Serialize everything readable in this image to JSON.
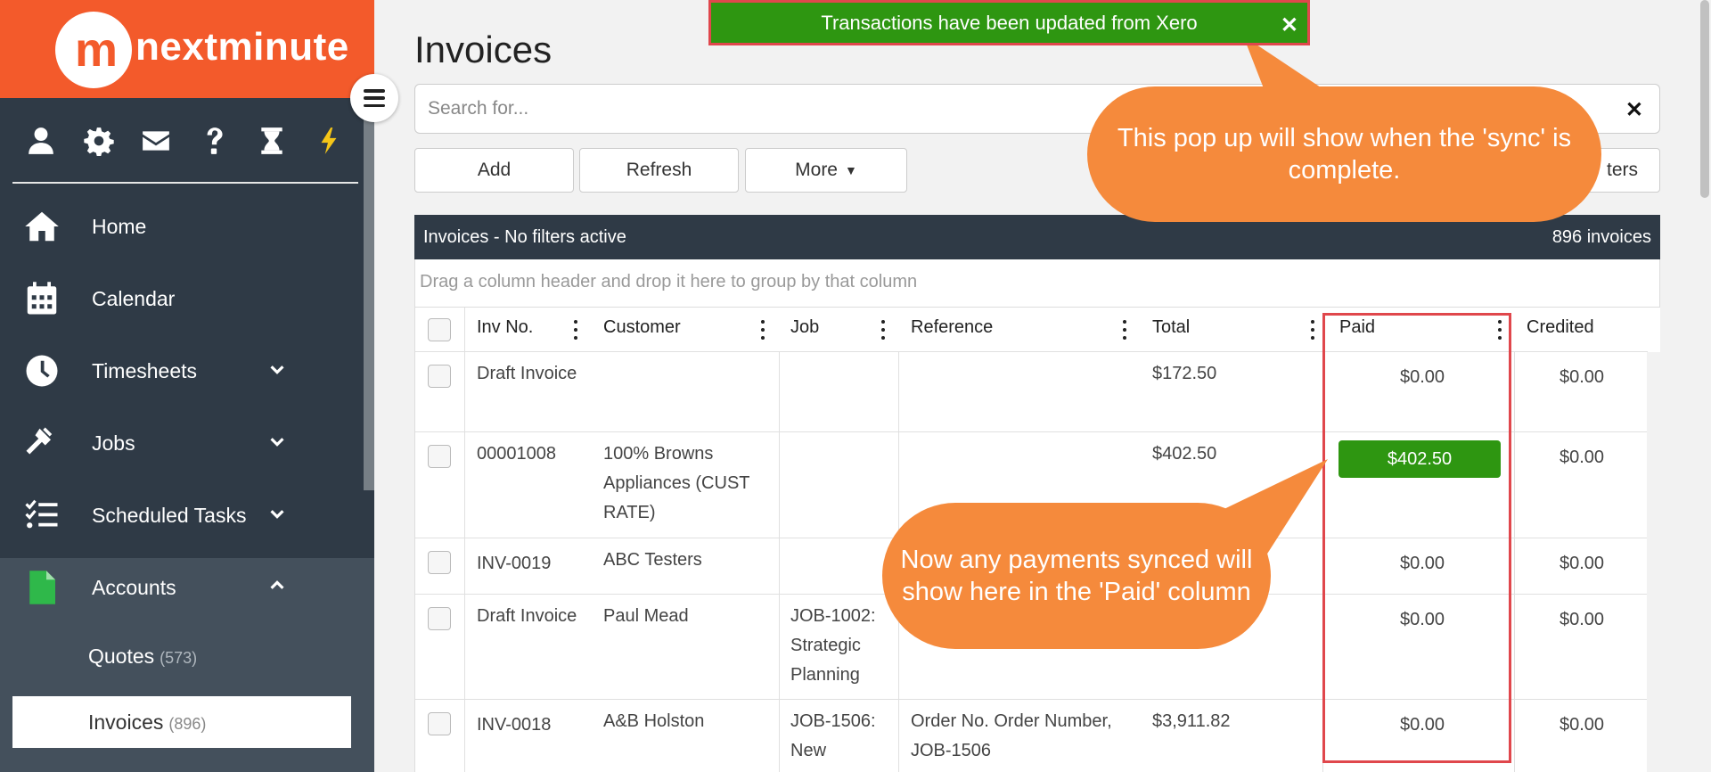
{
  "brand": {
    "logo_mark": "m",
    "logo_text": "nextminute",
    "color": "#f35a2b"
  },
  "top_icons": [
    "user-icon",
    "gear-icon",
    "envelope-icon",
    "question-icon",
    "hourglass-icon",
    "lightning-icon"
  ],
  "sidebar": {
    "items": [
      {
        "label": "Home",
        "icon": "home-icon"
      },
      {
        "label": "Calendar",
        "icon": "calendar-icon"
      },
      {
        "label": "Timesheets",
        "icon": "clock-icon",
        "expandable": true
      },
      {
        "label": "Jobs",
        "icon": "hammer-icon",
        "expandable": true
      },
      {
        "label": "Scheduled Tasks",
        "icon": "tasks-icon",
        "expandable": true
      },
      {
        "label": "Accounts",
        "icon": "file-icon",
        "expanded": true
      }
    ],
    "sub_items": [
      {
        "label": "Quotes",
        "count": "(573)"
      },
      {
        "label": "Invoices",
        "count": "(896)",
        "selected": true
      }
    ]
  },
  "page": {
    "title": "Invoices"
  },
  "search": {
    "placeholder": "Search for...",
    "value": "",
    "clear": "✕"
  },
  "toolbar": {
    "add": "Add",
    "refresh": "Refresh",
    "more": "More",
    "more_caret": "▼",
    "filters_partial": "ters"
  },
  "grid": {
    "title": "Invoices - No filters active",
    "count": "896 invoices",
    "group_hint": "Drag a column header and drop it here to group by that column",
    "columns": [
      "Inv No.",
      "Customer",
      "Job",
      "Reference",
      "Total",
      "Paid",
      "Credited"
    ],
    "rows": [
      {
        "inv_no": "Draft Invoice",
        "customer": "",
        "job": "",
        "reference": "",
        "total": "$172.50",
        "paid": "$0.00",
        "credited": "$0.00"
      },
      {
        "inv_no": "00001008",
        "customer": "100% Browns Appliances (CUST RATE)",
        "job": "",
        "reference": "",
        "total": "$402.50",
        "paid": "$402.50",
        "paid_highlight": true,
        "credited": "$0.00"
      },
      {
        "inv_no": "INV-0019",
        "customer": "ABC Testers",
        "job": "",
        "reference": "",
        "total": "",
        "paid": "$0.00",
        "credited": "$0.00"
      },
      {
        "inv_no": "Draft Invoice",
        "customer": "Paul Mead",
        "job": "JOB-1002: Strategic Planning",
        "reference": "",
        "total": "",
        "paid": "$0.00",
        "credited": "$0.00"
      },
      {
        "inv_no": "INV-0018",
        "customer": "A&B Holston",
        "job": "JOB-1506: New",
        "reference": "Order No. Order Number, JOB-1506",
        "total": "$3,911.82",
        "paid": "$0.00",
        "credited": "$0.00"
      }
    ]
  },
  "toast": {
    "message": "Transactions have been updated from Xero",
    "close": "✕",
    "color": "#2e9611"
  },
  "callouts": {
    "sync": "This pop up will show when the 'sync' is complete.",
    "paid": "Now any payments synced will show here in the 'Paid' column",
    "color": "#f58a3c"
  },
  "highlight_color": "#e0474c"
}
